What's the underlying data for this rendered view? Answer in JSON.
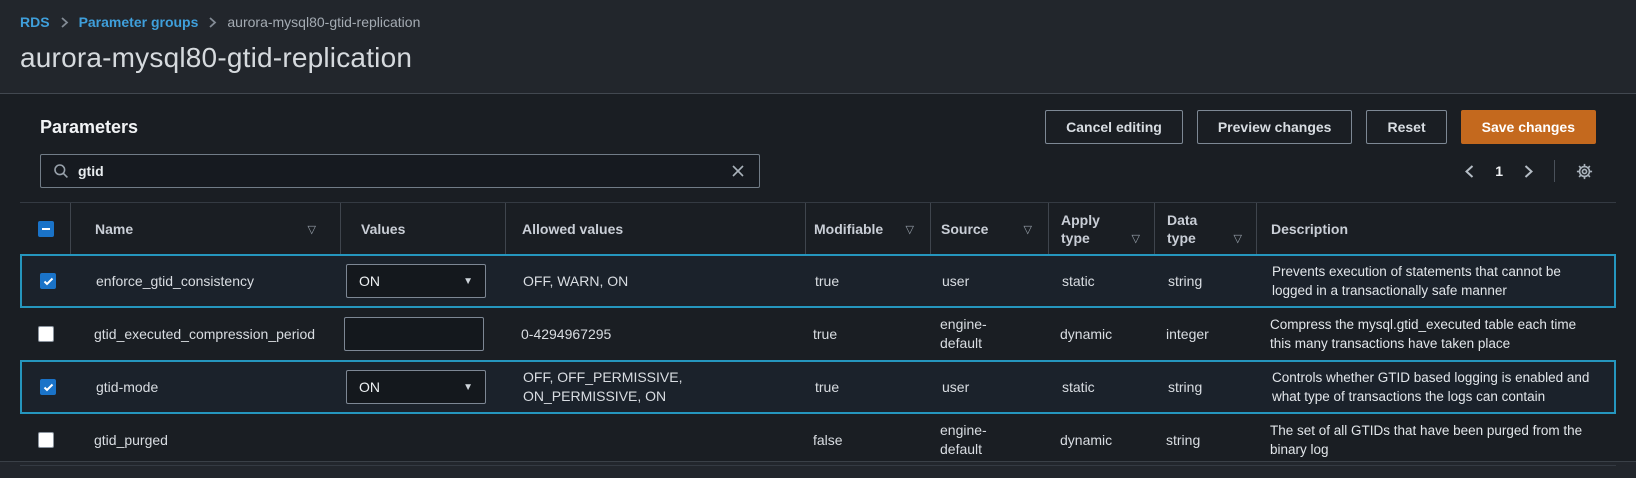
{
  "breadcrumb": {
    "items": [
      {
        "label": "RDS",
        "link": true
      },
      {
        "label": "Parameter groups",
        "link": true
      },
      {
        "label": "aurora-mysql80-gtid-replication",
        "link": false
      }
    ]
  },
  "page_title": "aurora-mysql80-gtid-replication",
  "panel": {
    "heading": "Parameters",
    "buttons": {
      "cancel": "Cancel editing",
      "preview": "Preview changes",
      "reset": "Reset",
      "save": "Save changes"
    },
    "search": {
      "value": "gtid",
      "icon": "search-icon",
      "clear_icon": "close-icon"
    },
    "pagination": {
      "current_page": "1",
      "prev_icon": "chevron-left-icon",
      "next_icon": "chevron-right-icon",
      "settings_icon": "gear-icon"
    }
  },
  "table": {
    "columns": [
      "Name",
      "Values",
      "Allowed values",
      "Modifiable",
      "Source",
      "Apply type",
      "Data type",
      "Description"
    ],
    "rows": [
      {
        "selected": true,
        "checked": true,
        "name": "enforce_gtid_consistency",
        "value_control": "select",
        "value": "ON",
        "allowed": "OFF, WARN, ON",
        "modifiable": "true",
        "source": "user",
        "apply_type": "static",
        "data_type": "string",
        "description": "Prevents execution of statements that cannot be logged in a transactionally safe manner"
      },
      {
        "selected": false,
        "checked": false,
        "name": "gtid_executed_compression_period",
        "value_control": "input",
        "value": "",
        "allowed": "0-4294967295",
        "modifiable": "true",
        "source": "engine-default",
        "apply_type": "dynamic",
        "data_type": "integer",
        "description": "Compress the mysql.gtid_executed table each time this many transactions have taken place"
      },
      {
        "selected": true,
        "checked": true,
        "name": "gtid-mode",
        "value_control": "select",
        "value": "ON",
        "allowed": "OFF, OFF_PERMISSIVE, ON_PERMISSIVE, ON",
        "modifiable": "true",
        "source": "user",
        "apply_type": "static",
        "data_type": "string",
        "description": "Controls whether GTID based logging is enabled and what type of transactions the logs can contain"
      },
      {
        "selected": false,
        "checked": false,
        "name": "gtid_purged",
        "value_control": "none",
        "value": "",
        "allowed": "",
        "modifiable": "false",
        "source": "engine-default",
        "apply_type": "dynamic",
        "data_type": "string",
        "description": "The set of all GTIDs that have been purged from the binary log"
      }
    ]
  },
  "colors": {
    "accent_orange": "#c4691e",
    "link_blue": "#3f9fdb",
    "selected_border": "#2596be",
    "checkbox_blue": "#1a73c8"
  },
  "sort_glyph": "▽",
  "caret_glyph": "▼"
}
